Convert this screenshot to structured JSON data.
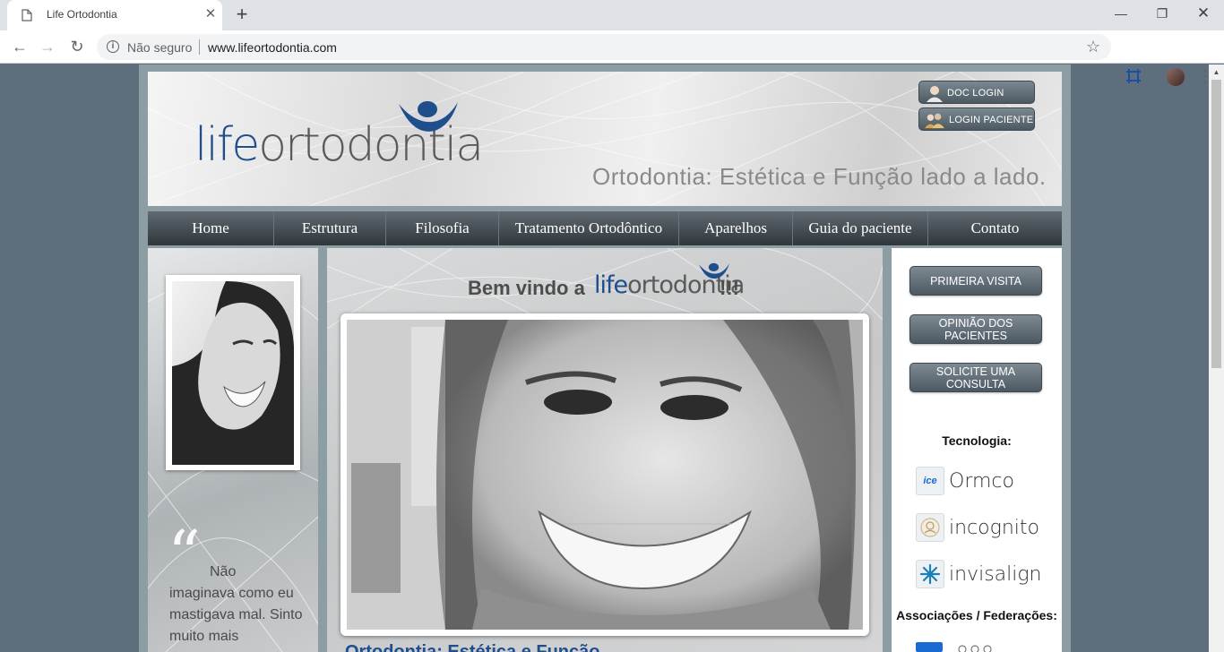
{
  "browser": {
    "tab_title": "Life Ortodontia",
    "new_tab": "+",
    "secure_label": "Não seguro",
    "url": "www.lifeortodontia.com"
  },
  "header": {
    "logo_part1": "life",
    "logo_part2": "ortodontia",
    "tagline": "Ortodontia: Estética e Função lado a lado.",
    "doc_login": "DOC LOGIN",
    "patient_login": "LOGIN PACIENTE"
  },
  "menu": [
    {
      "label": "Home"
    },
    {
      "label": "Estrutura"
    },
    {
      "label": "Filosofia"
    },
    {
      "label": "Tratamento Ortodôntico"
    },
    {
      "label": "Aparelhos"
    },
    {
      "label": "Guia do paciente"
    },
    {
      "label": "Contato"
    }
  ],
  "left": {
    "quote_mark": "“",
    "quote": "Não imaginava como eu mastigava mal. Sinto muito mais"
  },
  "center": {
    "welcome": "Bem vindo a",
    "welcome_logo_part1": "life",
    "welcome_logo_part2": "ortodontia",
    "welcome_suffix": "!!!",
    "section_title": "Ortodontia: Estética e Função"
  },
  "right": {
    "btn_primeira": "PRIMEIRA VISITA",
    "btn_opiniao": "OPINIÃO DOS PACIENTES",
    "btn_consulta": "SOLICITE UMA CONSULTA",
    "tecnologia": "Tecnologia:",
    "brands": [
      {
        "name": "Ormco",
        "badge": "ice"
      },
      {
        "name": "incognito",
        "badge": ""
      },
      {
        "name": "invisalign",
        "badge": ""
      }
    ],
    "associacoes": "Associações / Federações:"
  },
  "colors": {
    "brand_blue": "#1f4e8c",
    "page_bg": "#5f6e7c",
    "frame": "#8c9da3",
    "menu_dark": "#2f373c"
  }
}
